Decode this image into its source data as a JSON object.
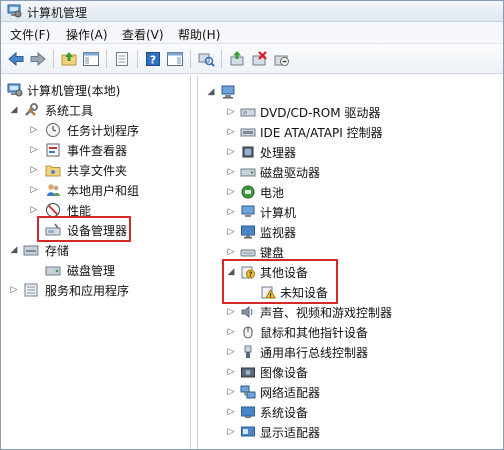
{
  "window": {
    "title": "计算机管理"
  },
  "menu": {
    "items": [
      "文件(F)",
      "操作(A)",
      "查看(V)",
      "帮助(H)"
    ]
  },
  "toolbar": {
    "buttons": [
      "back-arrow-icon",
      "forward-arrow-icon",
      "up-folder-icon",
      "show-hide-tree-icon",
      "properties-icon",
      "help-icon",
      "action-pane-icon",
      "scan-hardware-icon",
      "update-driver-icon",
      "uninstall-device-icon",
      "disable-device-icon"
    ]
  },
  "left_tree": {
    "root": "计算机管理(本地)",
    "system_tools": "系统工具",
    "task_scheduler": "任务计划程序",
    "event_viewer": "事件查看器",
    "shared_folders": "共享文件夹",
    "local_users": "本地用户和组",
    "performance": "性能",
    "device_manager": "设备管理器",
    "storage": "存储",
    "disk_management": "磁盘管理",
    "services_apps": "服务和应用程序"
  },
  "device_tree": {
    "items": [
      "DVD/CD-ROM 驱动器",
      "IDE ATA/ATAPI 控制器",
      "处理器",
      "磁盘驱动器",
      "电池",
      "计算机",
      "监视器",
      "键盘",
      "其他设备",
      "未知设备",
      "声音、视频和游戏控制器",
      "鼠标和其他指针设备",
      "通用串行总线控制器",
      "图像设备",
      "网络适配器",
      "系统设备",
      "显示适配器"
    ]
  },
  "colors": {
    "highlight": "#d62828",
    "accent": "#2b5fa8"
  }
}
